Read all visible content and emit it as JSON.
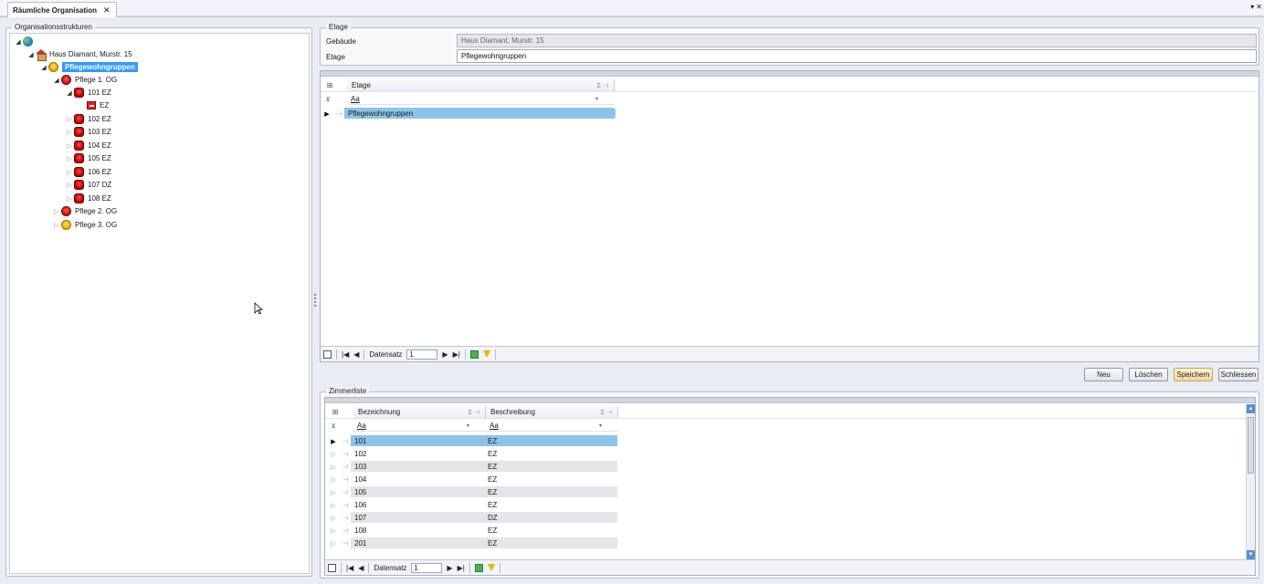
{
  "tab": {
    "title": "Räumliche Organisation",
    "close": "✕"
  },
  "window_menu": {
    "pin": "▾",
    "close": "✕"
  },
  "tree": {
    "group_title": "Organisationsstrukturen",
    "nodes": [
      {
        "label": "",
        "icon": "globe-icon"
      },
      {
        "label": "Haus Diamant, Murstr. 15",
        "icon": "house-icon"
      },
      {
        "label": "Pflegewohngruppen",
        "icon": "group-icon"
      },
      {
        "label": "Pflege 1. OG",
        "icon": "ward-icon"
      },
      {
        "label": "101  EZ",
        "icon": "room-icon"
      },
      {
        "label": "EZ",
        "icon": "bed-icon"
      },
      {
        "label": "102  EZ",
        "icon": "room-icon"
      },
      {
        "label": "103  EZ",
        "icon": "room-icon"
      },
      {
        "label": "104  EZ",
        "icon": "room-icon"
      },
      {
        "label": "105  EZ",
        "icon": "room-icon"
      },
      {
        "label": "106  EZ",
        "icon": "room-icon"
      },
      {
        "label": "107  DZ",
        "icon": "room-icon"
      },
      {
        "label": "108  EZ",
        "icon": "room-icon"
      },
      {
        "label": "Pflege 2. OG",
        "icon": "ward-icon"
      },
      {
        "label": "Pflege 3. OG",
        "icon": "group-icon"
      }
    ]
  },
  "etage": {
    "group_title": "Etage",
    "gebaeude_label": "Gebäude",
    "gebaeude_value": "Haus Diamant, Murstr. 15",
    "etage_label": "Etage",
    "etage_value": "Pflegewohngruppen"
  },
  "etage_grid": {
    "column": "Etage",
    "sum_icon": "Σ ⊣",
    "filter": "Aa",
    "rows": [
      "Pflegewohngruppen"
    ],
    "nav": {
      "label": "Datensatz",
      "record": "1"
    }
  },
  "buttons": {
    "neu": "Neu",
    "loeschen": "Löschen",
    "speichern": "Speichern",
    "schliessen": "Schliessen"
  },
  "zimmer": {
    "group_title": "Zimmerliste",
    "columns": [
      "Bezeichnung",
      "Beschreibung"
    ],
    "sum_icon": "Σ ⊣",
    "filter": "Aa",
    "rows": [
      [
        "101",
        "EZ"
      ],
      [
        "102",
        "EZ"
      ],
      [
        "103",
        "EZ"
      ],
      [
        "104",
        "EZ"
      ],
      [
        "105",
        "EZ"
      ],
      [
        "106",
        "EZ"
      ],
      [
        "107",
        "DZ"
      ],
      [
        "108",
        "EZ"
      ],
      [
        "201",
        "EZ"
      ]
    ],
    "nav": {
      "label": "Datensatz",
      "record": "1"
    }
  }
}
